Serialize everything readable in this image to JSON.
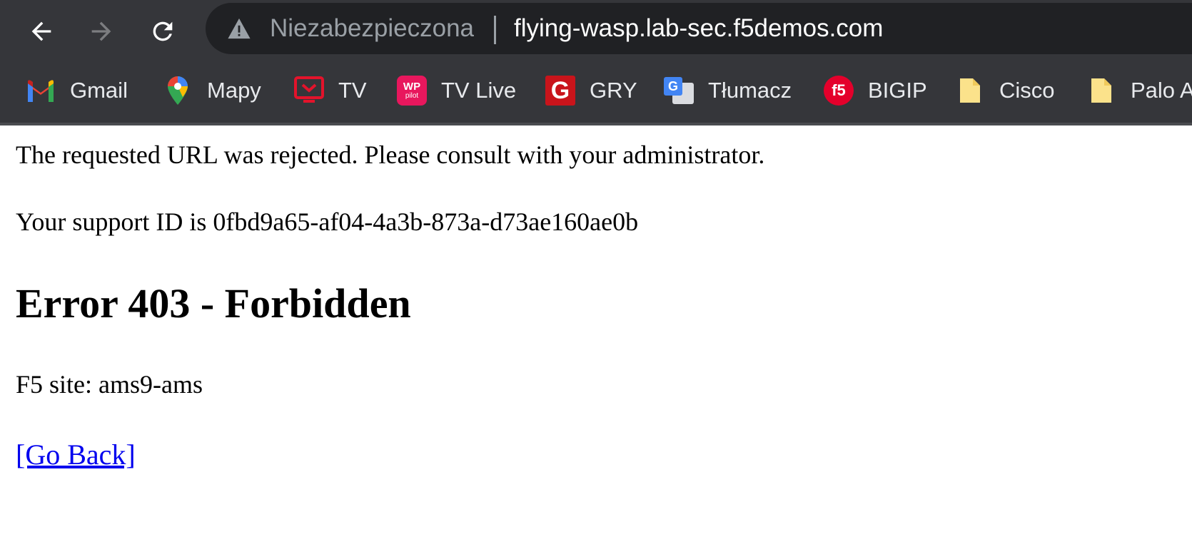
{
  "browser": {
    "security_label": "Niezabezpieczona",
    "url": "flying-wasp.lab-sec.f5demos.com",
    "icons": [
      "back-arrow-icon",
      "forward-arrow-icon",
      "reload-icon",
      "warning-triangle-icon"
    ],
    "bookmarks": [
      {
        "label": "Gmail",
        "icon": "gmail-icon"
      },
      {
        "label": "Mapy",
        "icon": "maps-pin-icon"
      },
      {
        "label": "TV",
        "icon": "tv-icon"
      },
      {
        "label": "TV Live",
        "icon": "wp-pilot-icon"
      },
      {
        "label": "GRY",
        "icon": "gry-icon"
      },
      {
        "label": "Tłumacz",
        "icon": "translate-icon"
      },
      {
        "label": "BIGIP",
        "icon": "f5-icon"
      },
      {
        "label": "Cisco",
        "icon": "folder-icon"
      },
      {
        "label": "Palo A",
        "icon": "folder-icon"
      }
    ]
  },
  "page": {
    "message": "The requested URL was rejected. Please consult with your administrator.",
    "support_id": "Your support ID is 0fbd9a65-af04-4a3b-873a-d73ae160ae0b",
    "title": "Error 403 - Forbidden",
    "site": "F5 site: ams9-ams",
    "go_back": "[Go Back]",
    "wp_icon_text_top": "WP",
    "wp_icon_text_bottom": "pilot",
    "gry_icon_letter": "G",
    "translate_icon_letter": "G",
    "f5_icon_text": "f5"
  },
  "colors": {
    "chrome_bg": "#35363a",
    "omnibox_bg": "#202124",
    "link": "#0000ee"
  }
}
